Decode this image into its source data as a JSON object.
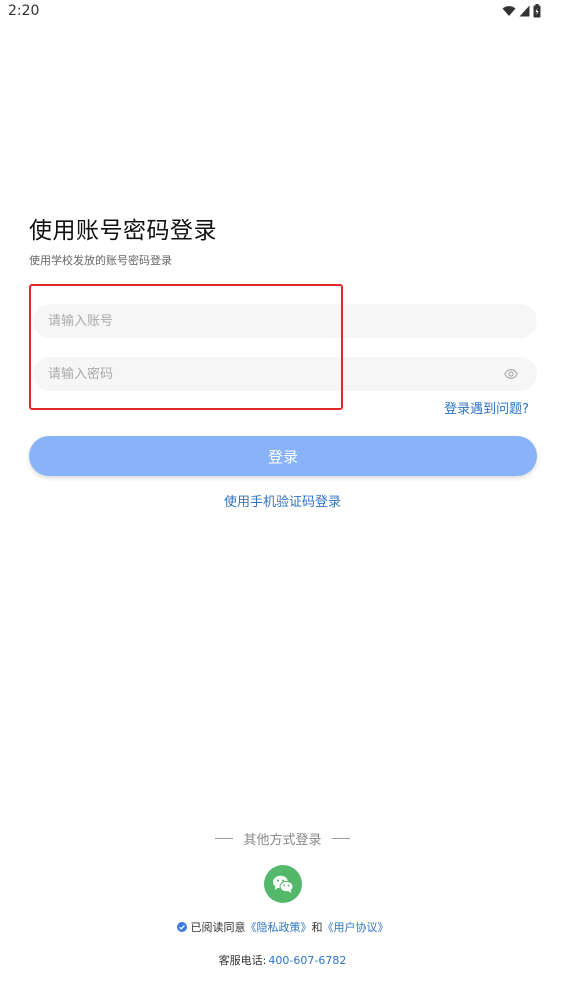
{
  "status_bar": {
    "time": "2:20"
  },
  "login": {
    "title": "使用账号密码登录",
    "subtitle": "使用学校发放的账号密码登录",
    "account_placeholder": "请输入账号",
    "password_placeholder": "请输入密码",
    "problem_link": "登录遇到问题?",
    "login_button": "登录",
    "sms_login_link": "使用手机验证码登录"
  },
  "other_login": {
    "label": "其他方式登录"
  },
  "agreement": {
    "prefix": "已阅读同意",
    "privacy": "《隐私政策》",
    "and": "和",
    "user_agreement": "《用户协议》"
  },
  "service": {
    "label": "客服电话:",
    "phone": "400-607-6782"
  },
  "colors": {
    "accent": "#2e74c6",
    "button": "#89b3f8",
    "wechat": "#53b86a",
    "highlight": "#e02a2a"
  }
}
